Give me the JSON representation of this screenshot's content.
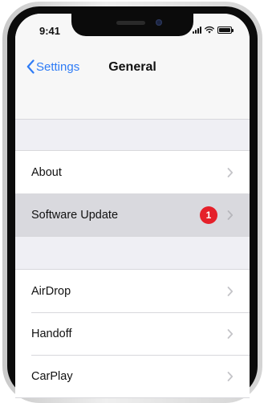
{
  "status_bar": {
    "time": "9:41",
    "icons": [
      "cellular-signal-icon",
      "wifi-icon",
      "battery-icon"
    ]
  },
  "nav": {
    "back_label": "Settings",
    "title": "General",
    "back_icon": "chevron-left-icon"
  },
  "groups": [
    {
      "items": [
        {
          "label": "About",
          "icon": "chevron-right-icon"
        },
        {
          "label": "Software Update",
          "badge": "1",
          "highlighted": true,
          "icon": "chevron-right-icon"
        }
      ]
    },
    {
      "items": [
        {
          "label": "AirDrop",
          "icon": "chevron-right-icon"
        },
        {
          "label": "Handoff",
          "icon": "chevron-right-icon"
        },
        {
          "label": "CarPlay",
          "icon": "chevron-right-icon"
        }
      ]
    }
  ],
  "colors": {
    "accent": "#2f7cf6",
    "badge": "#e5202a",
    "background": "#efeff4",
    "highlight": "#d9d9de"
  }
}
